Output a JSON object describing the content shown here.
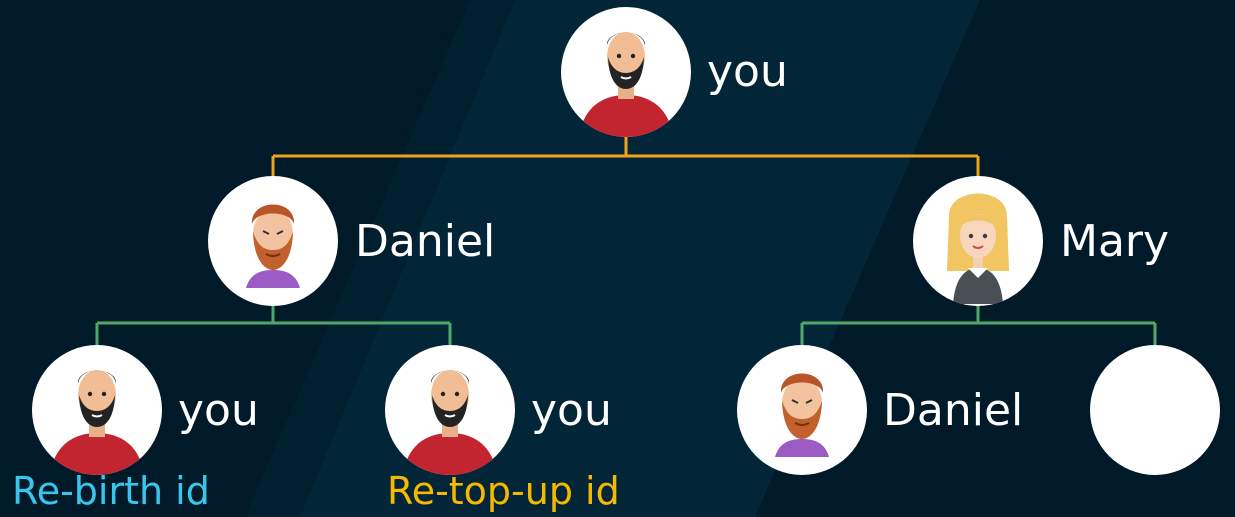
{
  "colors": {
    "background": "#001a29",
    "stripe": "#022638",
    "top_connector": "#f0a21c",
    "child_connector": "#4ea866",
    "node_fill": "#ffffff",
    "name_text": "#ffffff",
    "rebirth_label": "#39c6ec",
    "topup_label": "#f6b800"
  },
  "tree": {
    "root": {
      "name": "you",
      "avatar": "man-dark-beard-icon"
    },
    "left": {
      "name": "Daniel",
      "avatar": "man-red-beard-icon"
    },
    "right": {
      "name": "Mary",
      "avatar": "girl-blonde-icon"
    },
    "left_left": {
      "name": "you",
      "avatar": "man-dark-beard-icon",
      "tag": "Re-birth id"
    },
    "left_right": {
      "name": "you",
      "avatar": "man-dark-beard-icon",
      "tag": "Re-top-up id"
    },
    "right_left": {
      "name": "Daniel",
      "avatar": "man-red-beard-icon"
    },
    "right_right": {
      "name": "",
      "avatar": ""
    }
  }
}
